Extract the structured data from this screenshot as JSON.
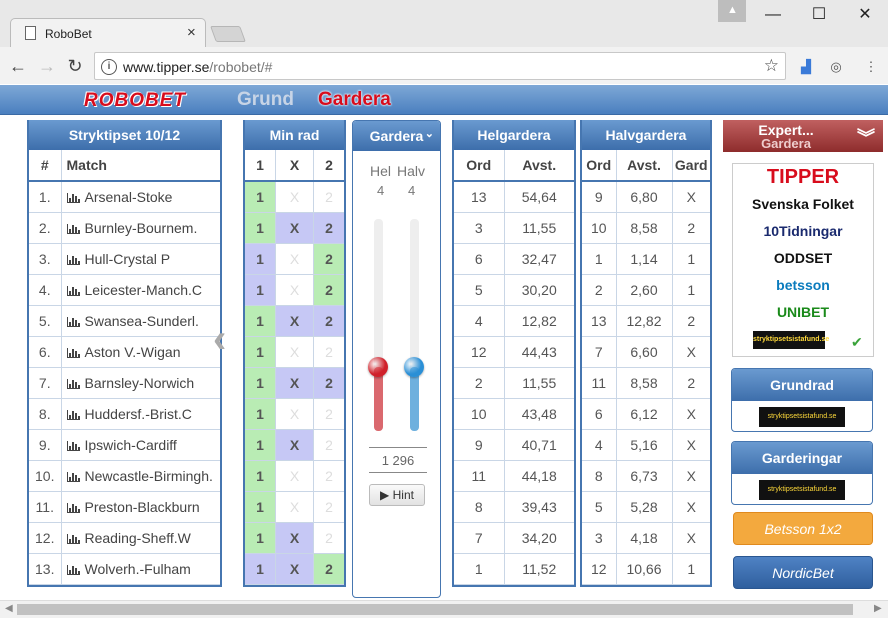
{
  "browser": {
    "tab_title": "RoboBet",
    "url_host": "www.tipper.se",
    "url_path": "/robobet/#",
    "minimize": "—",
    "maximize": "☐",
    "close": "✕"
  },
  "nav": {
    "logo": "ROBOBET",
    "grund": "Grund",
    "gardera": "Gardera"
  },
  "stryk": {
    "title": "Stryktipset 10/12",
    "col_num": "#",
    "col_match": "Match",
    "rows": [
      {
        "n": "1.",
        "match": "Arsenal-Stoke"
      },
      {
        "n": "2.",
        "match": "Burnley-Bournem."
      },
      {
        "n": "3.",
        "match": "Hull-Crystal P"
      },
      {
        "n": "4.",
        "match": "Leicester-Manch.C"
      },
      {
        "n": "5.",
        "match": "Swansea-Sunderl."
      },
      {
        "n": "6.",
        "match": "Aston V.-Wigan"
      },
      {
        "n": "7.",
        "match": "Barnsley-Norwich"
      },
      {
        "n": "8.",
        "match": "Huddersf.-Brist.C"
      },
      {
        "n": "9.",
        "match": "Ipswich-Cardiff"
      },
      {
        "n": "10.",
        "match": "Newcastle-Birmingh."
      },
      {
        "n": "11.",
        "match": "Preston-Blackburn"
      },
      {
        "n": "12.",
        "match": "Reading-Sheff.W"
      },
      {
        "n": "13.",
        "match": "Wolverh.-Fulham"
      }
    ]
  },
  "minrad": {
    "title": "Min rad",
    "cols": [
      "1",
      "X",
      "2"
    ],
    "rows": [
      [
        {
          "v": "1",
          "s": "g"
        },
        {
          "v": "X",
          "s": "e"
        },
        {
          "v": "2",
          "s": "e"
        }
      ],
      [
        {
          "v": "1",
          "s": "g"
        },
        {
          "v": "X",
          "s": "b"
        },
        {
          "v": "2",
          "s": "b"
        }
      ],
      [
        {
          "v": "1",
          "s": "b"
        },
        {
          "v": "X",
          "s": "e"
        },
        {
          "v": "2",
          "s": "g"
        }
      ],
      [
        {
          "v": "1",
          "s": "b"
        },
        {
          "v": "X",
          "s": "e"
        },
        {
          "v": "2",
          "s": "g"
        }
      ],
      [
        {
          "v": "1",
          "s": "g"
        },
        {
          "v": "X",
          "s": "b"
        },
        {
          "v": "2",
          "s": "b"
        }
      ],
      [
        {
          "v": "1",
          "s": "g"
        },
        {
          "v": "X",
          "s": "e"
        },
        {
          "v": "2",
          "s": "e"
        }
      ],
      [
        {
          "v": "1",
          "s": "g"
        },
        {
          "v": "X",
          "s": "b"
        },
        {
          "v": "2",
          "s": "b"
        }
      ],
      [
        {
          "v": "1",
          "s": "g"
        },
        {
          "v": "X",
          "s": "e"
        },
        {
          "v": "2",
          "s": "e"
        }
      ],
      [
        {
          "v": "1",
          "s": "g"
        },
        {
          "v": "X",
          "s": "b"
        },
        {
          "v": "2",
          "s": "e"
        }
      ],
      [
        {
          "v": "1",
          "s": "g"
        },
        {
          "v": "X",
          "s": "e"
        },
        {
          "v": "2",
          "s": "e"
        }
      ],
      [
        {
          "v": "1",
          "s": "g"
        },
        {
          "v": "X",
          "s": "e"
        },
        {
          "v": "2",
          "s": "e"
        }
      ],
      [
        {
          "v": "1",
          "s": "g"
        },
        {
          "v": "X",
          "s": "b"
        },
        {
          "v": "2",
          "s": "e"
        }
      ],
      [
        {
          "v": "1",
          "s": "b"
        },
        {
          "v": "X",
          "s": "b"
        },
        {
          "v": "2",
          "s": "g"
        }
      ]
    ]
  },
  "gardera": {
    "title": "Gardera",
    "hel_label": "Hel",
    "halv_label": "Halv",
    "hel_value": "4",
    "halv_value": "4",
    "hel_level": 0.3,
    "halv_level": 0.3,
    "total": "1 296",
    "hint_label": "▶ Hint",
    "hel_color": "#d0202a",
    "halv_color": "#2a8fd6"
  },
  "helgardera": {
    "title": "Helgardera",
    "cols": [
      "Ord",
      "Avst."
    ],
    "rows": [
      [
        "13",
        "54,64"
      ],
      [
        "3",
        "11,55"
      ],
      [
        "6",
        "32,47"
      ],
      [
        "5",
        "30,20"
      ],
      [
        "4",
        "12,82"
      ],
      [
        "12",
        "44,43"
      ],
      [
        "2",
        "11,55"
      ],
      [
        "10",
        "43,48"
      ],
      [
        "9",
        "40,71"
      ],
      [
        "11",
        "44,18"
      ],
      [
        "8",
        "39,43"
      ],
      [
        "7",
        "34,20"
      ],
      [
        "1",
        "11,52"
      ]
    ]
  },
  "halvgardera": {
    "title": "Halvgardera",
    "cols": [
      "Ord",
      "Avst.",
      "Gard"
    ],
    "rows": [
      [
        "9",
        "6,80",
        "X"
      ],
      [
        "10",
        "8,58",
        "2"
      ],
      [
        "1",
        "1,14",
        "1"
      ],
      [
        "2",
        "2,60",
        "1"
      ],
      [
        "13",
        "12,82",
        "2"
      ],
      [
        "7",
        "6,60",
        "X"
      ],
      [
        "11",
        "8,58",
        "2"
      ],
      [
        "6",
        "6,12",
        "X"
      ],
      [
        "4",
        "5,16",
        "X"
      ],
      [
        "8",
        "6,73",
        "X"
      ],
      [
        "5",
        "5,28",
        "X"
      ],
      [
        "3",
        "4,18",
        "X"
      ],
      [
        "12",
        "10,66",
        "1"
      ]
    ]
  },
  "sidebar": {
    "expert_title": "Expert...",
    "expert_sub": "Gardera",
    "brands": [
      {
        "name": "TIPPER",
        "color": "#d80c1c"
      },
      {
        "name": "Svenska Folket",
        "color": "#111111"
      },
      {
        "name": "10Tidningar",
        "color": "#1a2a6e"
      },
      {
        "name": "ODDSET",
        "color": "#111111"
      },
      {
        "name": "betsson",
        "color": "#0a7bbd"
      },
      {
        "name": "UNIBET",
        "color": "#1a8a1a"
      },
      {
        "name": "stryktipsetsistafund.se",
        "color": "#ffda3a"
      }
    ],
    "grundrad": "Grundrad",
    "garderingar": "Garderingar",
    "stryk_logo": "stryktipsetsistafund.se",
    "betsson": "Betsson 1x2",
    "nordicbet": "NordicBet"
  }
}
